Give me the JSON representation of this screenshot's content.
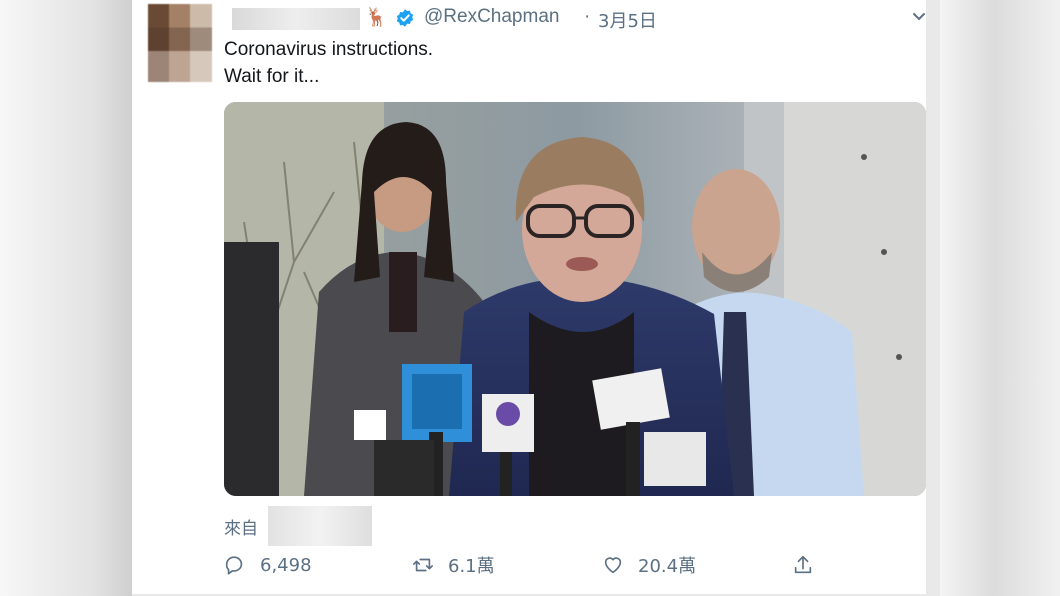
{
  "tweet": {
    "handle": "@RexChapman",
    "separator": "·",
    "date": "3月5日",
    "text_lines": [
      "Coronavirus instructions.",
      "Wait for it..."
    ],
    "source_label": "來自",
    "media_description": "Press conference video: a woman with glasses speaking at microphones, a woman and a bearded man standing behind her"
  },
  "actions": {
    "replies": "6,498",
    "retweets": "6.1萬",
    "likes": "20.4萬"
  },
  "colors": {
    "secondary_text": "#5b7083",
    "verified_blue": "#1da1f2",
    "primary_text": "#14171a"
  },
  "icons": {
    "verified": "verified-badge-icon",
    "reply": "reply-icon",
    "retweet": "retweet-icon",
    "like": "heart-icon",
    "share": "share-icon",
    "caret": "chevron-down-icon"
  }
}
